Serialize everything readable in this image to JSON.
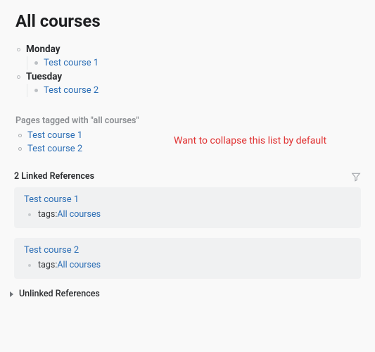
{
  "title": "All courses",
  "outline": {
    "days": [
      {
        "label": "Monday",
        "items": [
          {
            "label": "Test course 1"
          }
        ]
      },
      {
        "label": "Tuesday",
        "items": [
          {
            "label": "Test course 2"
          }
        ]
      }
    ]
  },
  "tagged": {
    "header": "Pages tagged with \"all courses\"",
    "items": [
      {
        "label": "Test course 1"
      },
      {
        "label": "Test course 2"
      }
    ]
  },
  "annotation": "Want to collapse this list by default",
  "linked_refs": {
    "header": "2 Linked References",
    "cards": [
      {
        "title": "Test course 1",
        "tags_label": "tags: ",
        "tags_value": "All courses"
      },
      {
        "title": "Test course 2",
        "tags_label": "tags: ",
        "tags_value": "All courses"
      }
    ]
  },
  "unlinked_refs": {
    "header": "Unlinked References"
  }
}
